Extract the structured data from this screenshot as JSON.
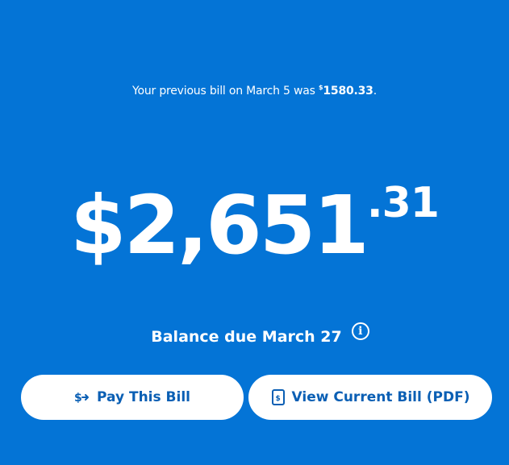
{
  "previous_bill": {
    "prefix": "Your previous bill on March 5 was ",
    "currency_symbol": "$",
    "amount": "1580.33",
    "suffix": "."
  },
  "balance": {
    "main": "$2,651",
    "cents": ".31"
  },
  "due": {
    "label": "Balance due March 27",
    "info_icon": "info-icon"
  },
  "actions": {
    "pay_label": "Pay This Bill",
    "pay_icon": "dollar-transfer-icon",
    "view_label": "View Current Bill (PDF)",
    "view_icon": "bill-document-icon"
  },
  "colors": {
    "background": "#0474d6",
    "text": "#ffffff",
    "button_bg": "#ffffff",
    "button_text": "#0a5fb4"
  }
}
